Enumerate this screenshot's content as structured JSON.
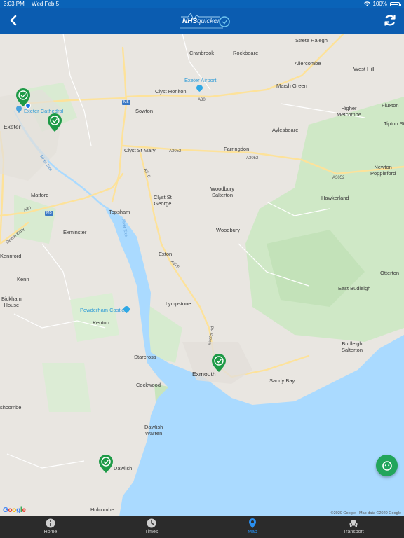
{
  "status_bar": {
    "time": "3:03 PM",
    "date": "Wed Feb 5",
    "battery": "100%"
  },
  "nav": {
    "logo_nhs": "NHS",
    "logo_quicker": "quicker",
    "back_icon": "chevron-left-icon",
    "refresh_icon": "refresh-icon"
  },
  "map": {
    "places": [
      {
        "id": "strete-ralegh",
        "text": "Strete Ralegh"
      },
      {
        "id": "cranbrook",
        "text": "Cranbrook"
      },
      {
        "id": "rockbeare",
        "text": "Rockbeare"
      },
      {
        "id": "allercombe",
        "text": "Allercombe"
      },
      {
        "id": "west-hill",
        "text": "West Hill"
      },
      {
        "id": "exeter-airport",
        "text": "Exeter Airport"
      },
      {
        "id": "clyst-honiton",
        "text": "Clyst Honiton"
      },
      {
        "id": "marsh-green",
        "text": "Marsh Green"
      },
      {
        "id": "exeter-cathedral",
        "text": "Exeter Cathedral"
      },
      {
        "id": "sowton",
        "text": "Sowton"
      },
      {
        "id": "higher-metcombe",
        "text": "Higher\nMetcombe"
      },
      {
        "id": "fluxton",
        "text": "Fluxton"
      },
      {
        "id": "exeter",
        "text": "Exeter"
      },
      {
        "id": "tipton",
        "text": "Tipton St"
      },
      {
        "id": "aylesbeare",
        "text": "Aylesbeare"
      },
      {
        "id": "clyst-st-mary",
        "text": "Clyst St Mary"
      },
      {
        "id": "farringdon",
        "text": "Farringdon"
      },
      {
        "id": "newton-poppleford",
        "text": "Newton\nPoppleford"
      },
      {
        "id": "woodbury-salterton",
        "text": "Woodbury\nSalterton"
      },
      {
        "id": "matford",
        "text": "Matford"
      },
      {
        "id": "hawkerland",
        "text": "Hawkerland"
      },
      {
        "id": "clyst-st-george",
        "text": "Clyst St\nGeorge"
      },
      {
        "id": "topsham",
        "text": "Topsham"
      },
      {
        "id": "exminster",
        "text": "Exminster"
      },
      {
        "id": "woodbury",
        "text": "Woodbury"
      },
      {
        "id": "kennford",
        "text": "Kennford"
      },
      {
        "id": "exton",
        "text": "Exton"
      },
      {
        "id": "otterton",
        "text": "Otterton"
      },
      {
        "id": "kenn",
        "text": "Kenn"
      },
      {
        "id": "east-budleigh",
        "text": "East Budleigh"
      },
      {
        "id": "bickham-house",
        "text": "Bickham\nHouse"
      },
      {
        "id": "lympstone",
        "text": "Lympstone"
      },
      {
        "id": "powderham-castle",
        "text": "Powderham Castle"
      },
      {
        "id": "kenton",
        "text": "Kenton"
      },
      {
        "id": "budleigh-salterton",
        "text": "Budleigh\nSalterton"
      },
      {
        "id": "starcross",
        "text": "Starcross"
      },
      {
        "id": "exmouth",
        "text": "Exmouth"
      },
      {
        "id": "sandy-bay",
        "text": "Sandy Bay"
      },
      {
        "id": "cockwood",
        "text": "Cockwood"
      },
      {
        "id": "ashcombe",
        "text": "shcombe"
      },
      {
        "id": "dawlish-warren",
        "text": "Dawlish\nWarren"
      },
      {
        "id": "dawlish",
        "text": "Dawlish"
      },
      {
        "id": "holcombe",
        "text": "Holcombe"
      }
    ],
    "roads": {
      "m5_a": "M5",
      "m5_b": "M5",
      "a30_a": "A30",
      "a30_b": "A30",
      "a3052_a": "A3052",
      "a3052_b": "A3052",
      "a3052_c": "A3052",
      "a376_a": "A376",
      "a376_b": "A376",
      "exeter_rd": "Exeter Rd",
      "devon_expy": "Devon Expy",
      "river_exe_a": "River Exe",
      "river_exe_b": "River Exe"
    },
    "google_logo": [
      "G",
      "o",
      "o",
      "g",
      "l",
      "e"
    ],
    "attribution": "©2020 Google - Map data ©2020 Google",
    "water_color": "#aadaff",
    "land_color": "#e9e6e1",
    "park_color": "#c8e6c1",
    "road_color": "#fde29a",
    "marker_color": "#1e9a47"
  },
  "fab": {
    "icon": "chat-face-icon",
    "color": "#22a55b"
  },
  "tabs": [
    {
      "label": "Home",
      "icon": "info-icon",
      "active": false
    },
    {
      "label": "Times",
      "icon": "clock-icon",
      "active": false
    },
    {
      "label": "Map",
      "icon": "map-pin-icon",
      "active": true
    },
    {
      "label": "Transport",
      "icon": "car-icon",
      "active": false
    }
  ]
}
